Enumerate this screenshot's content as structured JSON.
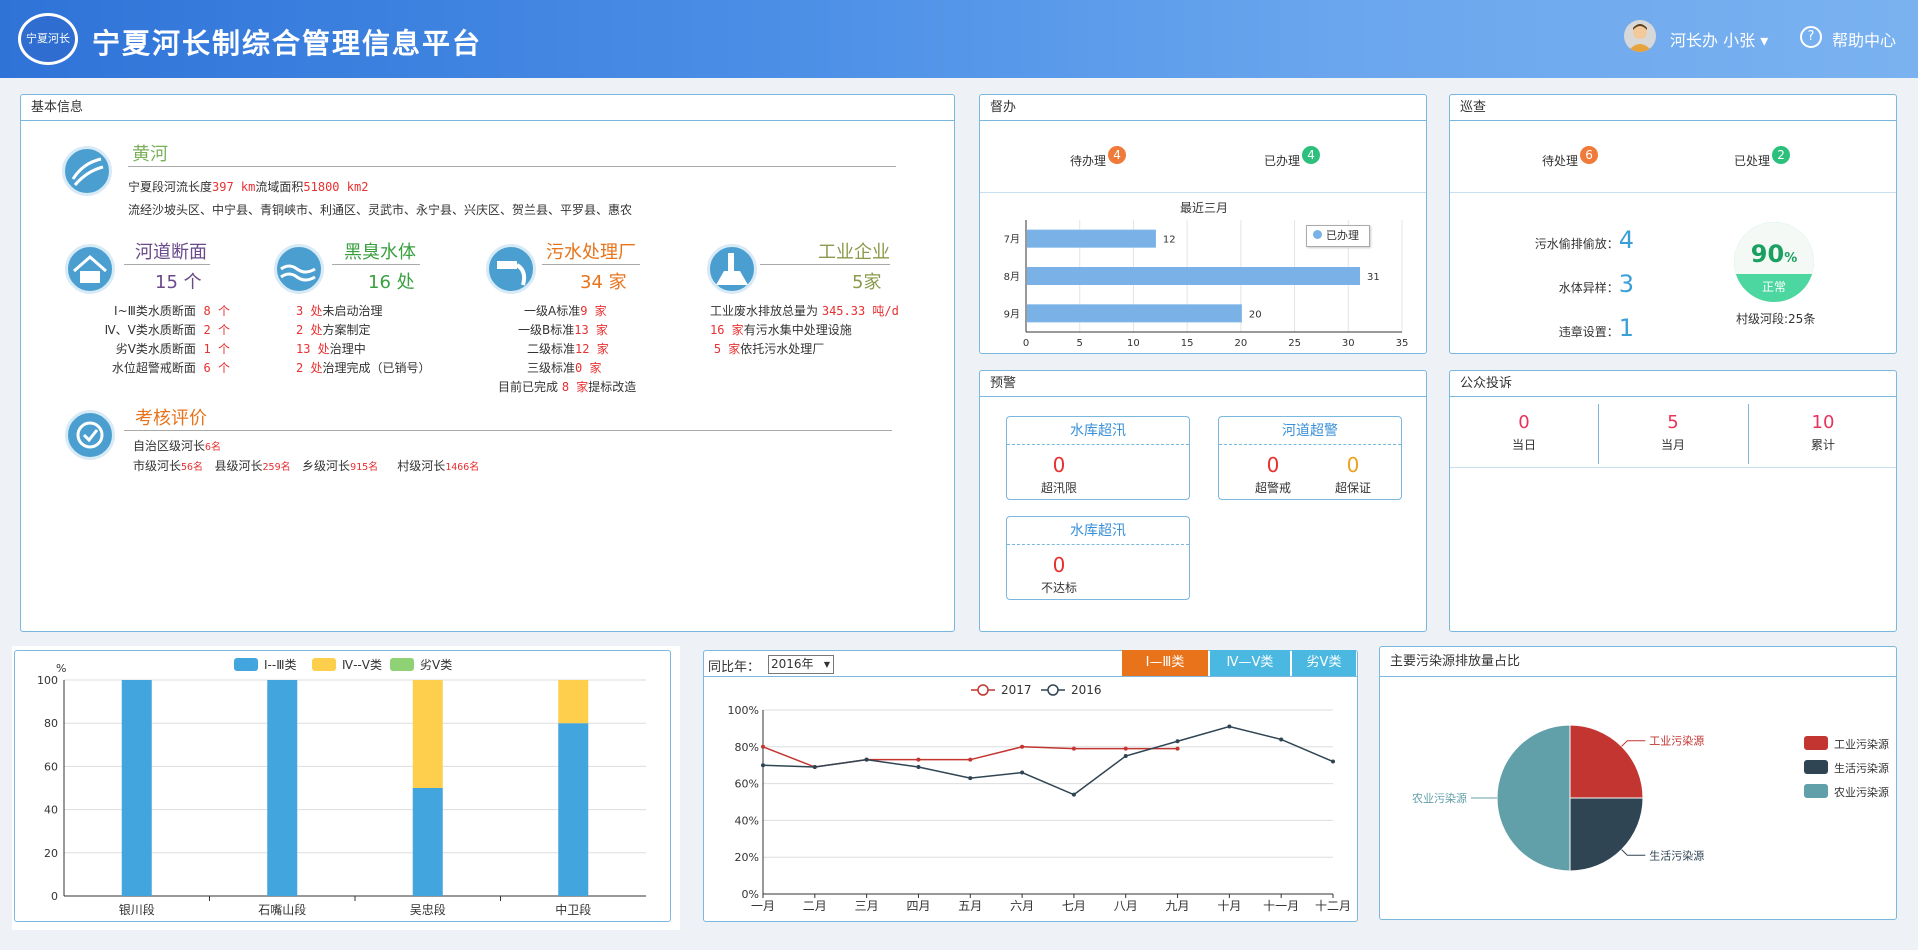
{
  "header": {
    "logo_text": "宁夏河长",
    "title": "宁夏河长制综合管理信息平台",
    "user": "河长办 小张",
    "help": "帮助中心"
  },
  "basic": {
    "title": "基本信息",
    "river": {
      "name": "黄河",
      "line1_a": "宁夏段河流长度",
      "length": "397 km",
      "line1_b": "流域面积",
      "area": "51800 km2",
      "line2": "流经沙坡头区、中宁县、青铜峡市、利通区、灵武市、永宁县、兴庆区、贺兰县、平罗县、惠农"
    },
    "cards": [
      {
        "title": "河道断面",
        "count": "15 个",
        "rows": [
          {
            "label": "Ⅰ~Ⅲ类水质断面",
            "val": "8 个"
          },
          {
            "label": "Ⅳ、Ⅴ类水质断面",
            "val": "2 个"
          },
          {
            "label": "劣Ⅴ类水质断面",
            "val": "1 个"
          },
          {
            "label": "水位超警戒断面",
            "val": "6 个"
          }
        ]
      },
      {
        "title": "黑臭水体",
        "count": "16 处",
        "rows": [
          {
            "val": "3 处",
            "label": "未启动治理"
          },
          {
            "val": "2 处",
            "label": "方案制定"
          },
          {
            "val": "13 处",
            "label": "治理中"
          },
          {
            "val": "2 处",
            "label": "治理完成（已销号）"
          }
        ]
      },
      {
        "title": "污水处理厂",
        "count": "34 家",
        "rows": [
          {
            "label": "一级A标准",
            "val": "9 家"
          },
          {
            "label": "一级B标准",
            "val": "13 家"
          },
          {
            "label": "二级标准",
            "val": "12 家"
          },
          {
            "label": "三级标准",
            "val": "0 家"
          }
        ],
        "extra_a": "目前已完成",
        "extra_val": "8 家",
        "extra_b": "提标改造"
      },
      {
        "title": "工业企业",
        "count": "5家",
        "r1_a": "工业废水排放总量为",
        "r1_val": "345.33 吨/d",
        "r2_val": "16 家",
        "r2_b": "有污水集中处理设施",
        "r3_val": "5 家",
        "r3_b": "依托污水处理厂"
      }
    ],
    "assess": {
      "title": "考核评价",
      "l1_a": "自治区级河长",
      "l1_val": "6名",
      "city_a": "市级河长",
      "city_val": "56名",
      "county_a": "县级河长",
      "county_val": "259名",
      "town_a": "乡级河长",
      "town_val": "915名",
      "village_a": "村级河长",
      "village_val": "1466名"
    }
  },
  "duban": {
    "title": "督办",
    "pending": "待办理",
    "pending_n": "4",
    "done": "已办理",
    "done_n": "4",
    "chart_title": "最近三月",
    "legend": "已办理"
  },
  "xuncha": {
    "title": "巡查",
    "pending": "待处理",
    "pending_n": "6",
    "done": "已处理",
    "done_n": "2",
    "items": [
      {
        "label": "污水偷排偷放：",
        "val": "4"
      },
      {
        "label": "水体异样：",
        "val": "3"
      },
      {
        "label": "违章设置：",
        "val": "1"
      }
    ],
    "gauge_val": "90",
    "gauge_unit": "%",
    "gauge_status": "正常",
    "gauge_caption": "村级河段:25条"
  },
  "yujing": {
    "title": "预警",
    "box1": {
      "title": "水库超汛",
      "n": "0",
      "lbl": "超汛限"
    },
    "box2": {
      "title": "河道超警",
      "n1": "0",
      "l1": "超警戒",
      "n2": "0",
      "l2": "超保证"
    },
    "box3": {
      "title": "水库超汛",
      "n": "0",
      "lbl": "不达标"
    }
  },
  "public": {
    "title": "公众投诉",
    "items": [
      {
        "n": "0",
        "lbl": "当日"
      },
      {
        "n": "5",
        "lbl": "当月"
      },
      {
        "n": "10",
        "lbl": "累计"
      }
    ]
  },
  "compare": {
    "label": "同比年：",
    "year": "2016年",
    "tabs": [
      "Ⅰ—Ⅲ类",
      "Ⅳ—Ⅴ类",
      "劣Ⅴ类"
    ]
  },
  "pollution": {
    "title": "主要污染源排放量占比"
  },
  "colors": {
    "blue": "#42a5de",
    "yellow": "#fecf4d",
    "green": "#8fd175",
    "red": "#c23531",
    "navy": "#2f4554",
    "teal": "#61a0a8",
    "orange": "#e8731a"
  },
  "chart_data": [
    {
      "type": "bar",
      "title": "最近三月",
      "categories": [
        "7月",
        "8月",
        "9月"
      ],
      "series": [
        {
          "name": "已办理",
          "values": [
            12,
            31,
            20
          ]
        }
      ],
      "xlim": [
        0,
        35
      ],
      "ticks": [
        0,
        5,
        10,
        15,
        20,
        25,
        30,
        35
      ],
      "orientation": "horizontal"
    },
    {
      "type": "bar",
      "ylabel": "%",
      "ylim": [
        0,
        100
      ],
      "ticks": [
        0,
        20,
        40,
        60,
        80,
        100
      ],
      "stacked": true,
      "categories": [
        "银川段",
        "石嘴山段",
        "吴忠段",
        "中卫段"
      ],
      "series": [
        {
          "name": "Ⅰ--Ⅲ类",
          "values": [
            100,
            100,
            50,
            80
          ]
        },
        {
          "name": "Ⅳ--Ⅴ类",
          "values": [
            0,
            0,
            50,
            20
          ]
        },
        {
          "name": "劣Ⅴ类",
          "values": [
            0,
            0,
            0,
            0
          ]
        }
      ]
    },
    {
      "type": "line",
      "ylim": [
        0,
        100
      ],
      "yticks": [
        "0%",
        "20%",
        "40%",
        "60%",
        "80%",
        "100%"
      ],
      "categories": [
        "一月",
        "二月",
        "三月",
        "四月",
        "五月",
        "六月",
        "七月",
        "八月",
        "九月",
        "十月",
        "十一月",
        "十二月"
      ],
      "series": [
        {
          "name": "2017",
          "values": [
            80,
            69,
            73,
            73,
            73,
            80,
            79,
            79,
            79,
            null,
            null,
            null
          ]
        },
        {
          "name": "2016",
          "values": [
            70,
            69,
            73,
            69,
            63,
            66,
            54,
            75,
            83,
            91,
            84,
            72
          ]
        }
      ]
    },
    {
      "type": "pie",
      "series": [
        {
          "name": "工业污染源",
          "value": 25
        },
        {
          "name": "生活污染源",
          "value": 25
        },
        {
          "name": "农业污染源",
          "value": 50
        }
      ]
    }
  ]
}
